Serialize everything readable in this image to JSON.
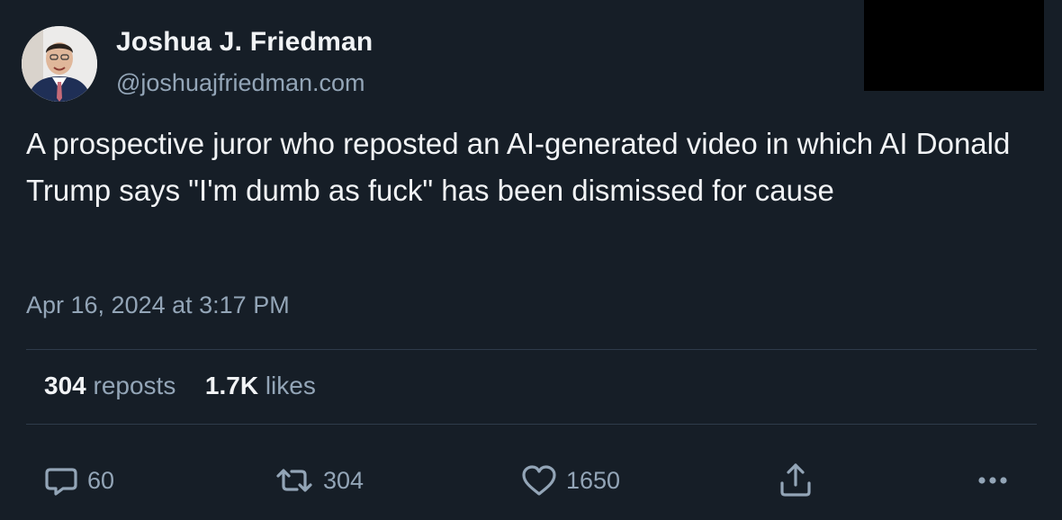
{
  "author": {
    "display_name": "Joshua J. Friedman",
    "handle": "@joshuajfriedman.com"
  },
  "post": {
    "text": "A prospective juror who reposted an AI-generated video in which AI Donald Trump says \"I'm dumb as fuck\" has been dismissed for cause",
    "timestamp": "Apr 16, 2024 at 3:17 PM"
  },
  "stats": {
    "reposts_count": "304",
    "reposts_label": "reposts",
    "likes_count": "1.7K",
    "likes_label": "likes"
  },
  "actions": {
    "reply_count": "60",
    "repost_count": "304",
    "like_count": "1650"
  },
  "icons": {
    "reply": "speech-bubble-icon",
    "repost": "repost-arrows-icon",
    "like": "heart-icon",
    "share": "share-upload-icon",
    "more": "more-dots-icon"
  },
  "colors": {
    "background": "#161e27",
    "text_primary": "#f1f3f5",
    "text_secondary": "#93a5b7",
    "divider": "#2e3b4a"
  }
}
